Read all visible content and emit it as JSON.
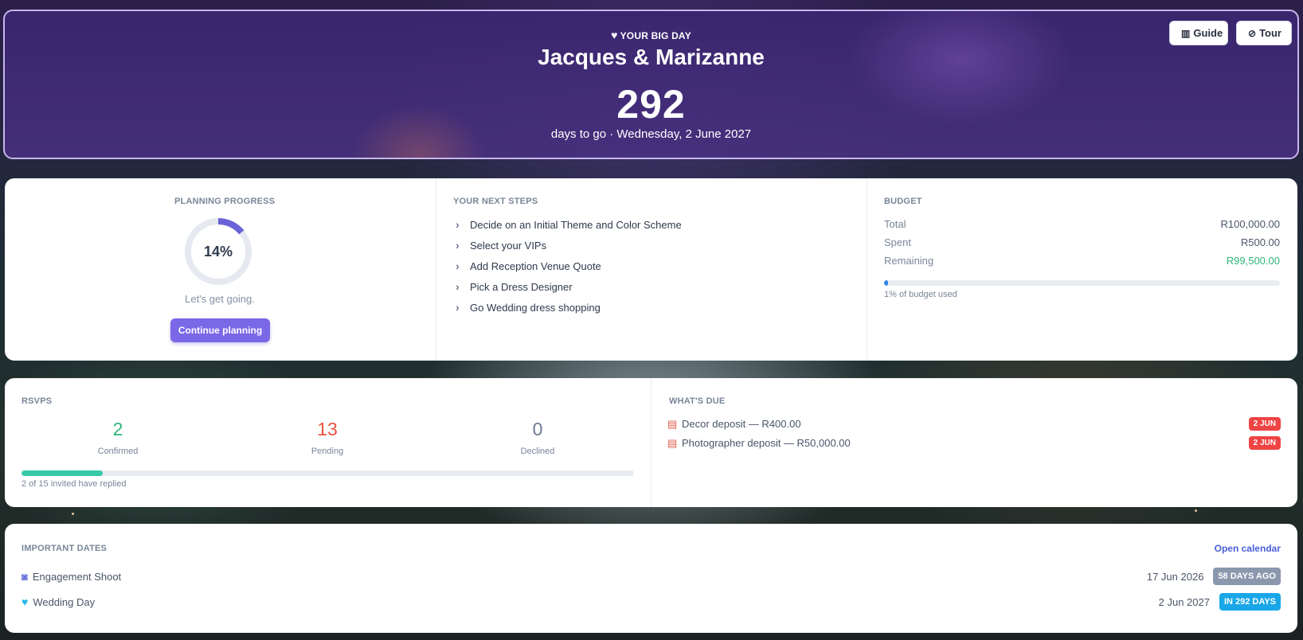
{
  "hero": {
    "kicker": "YOUR BIG DAY",
    "title": "Jacques & Marizanne",
    "days": "292",
    "subtitle": "days to go · Wednesday, 2 June 2027",
    "guide_label": "Guide",
    "tour_label": "Tour"
  },
  "progress": {
    "label": "PLANNING PROGRESS",
    "percent_text": "14%",
    "percent": 0.14,
    "caption": "Let's get going.",
    "button": "Continue planning"
  },
  "next_steps": {
    "label": "YOUR NEXT STEPS",
    "items": [
      "Decide on an Initial Theme and Color Scheme",
      "Select your VIPs",
      "Add Reception Venue Quote",
      "Pick a Dress Designer",
      "Go Wedding dress shopping"
    ]
  },
  "budget": {
    "label": "BUDGET",
    "total_label": "Total",
    "total": "R100,000.00",
    "spent_label": "Spent",
    "spent": "R500.00",
    "remaining_label": "Remaining",
    "remaining": "R99,500.00",
    "used_fraction": 0.01,
    "used_text": "1% of budget used"
  },
  "rsvps": {
    "label": "RSVPS",
    "confirmed": "2",
    "confirmed_label": "Confirmed",
    "pending": "13",
    "pending_label": "Pending",
    "declined": "0",
    "declined_label": "Declined",
    "replied_fraction": 0.133,
    "replied_text": "2 of 15 invited have replied"
  },
  "due": {
    "label": "WHAT'S DUE",
    "items": [
      {
        "text": "Decor deposit — R400.00",
        "badge": "2 JUN"
      },
      {
        "text": "Photographer deposit — R50,000.00",
        "badge": "2 JUN"
      }
    ]
  },
  "dates": {
    "label": "IMPORTANT DATES",
    "link": "Open calendar",
    "items": [
      {
        "name": "Engagement Shoot",
        "date": "17 Jun 2026",
        "badge": "58 DAYS AGO",
        "icon": "camera-icon"
      },
      {
        "name": "Wedding Day",
        "date": "2 Jun 2027",
        "badge": "IN 292 DAYS",
        "icon": "heart-icon"
      }
    ]
  },
  "colors": {
    "accent": "#7a68e6",
    "confirmed": "#2fb67a",
    "pending": "#e8533f",
    "declined": "#6b7a90",
    "rsvp_bar": "#37c9a6",
    "budget_bar": "#2f86e6",
    "due_badge": "#ef4444",
    "ago_badge": "#8b97ad",
    "future_badge": "#1aa7e8",
    "link": "#4a5fd9"
  }
}
